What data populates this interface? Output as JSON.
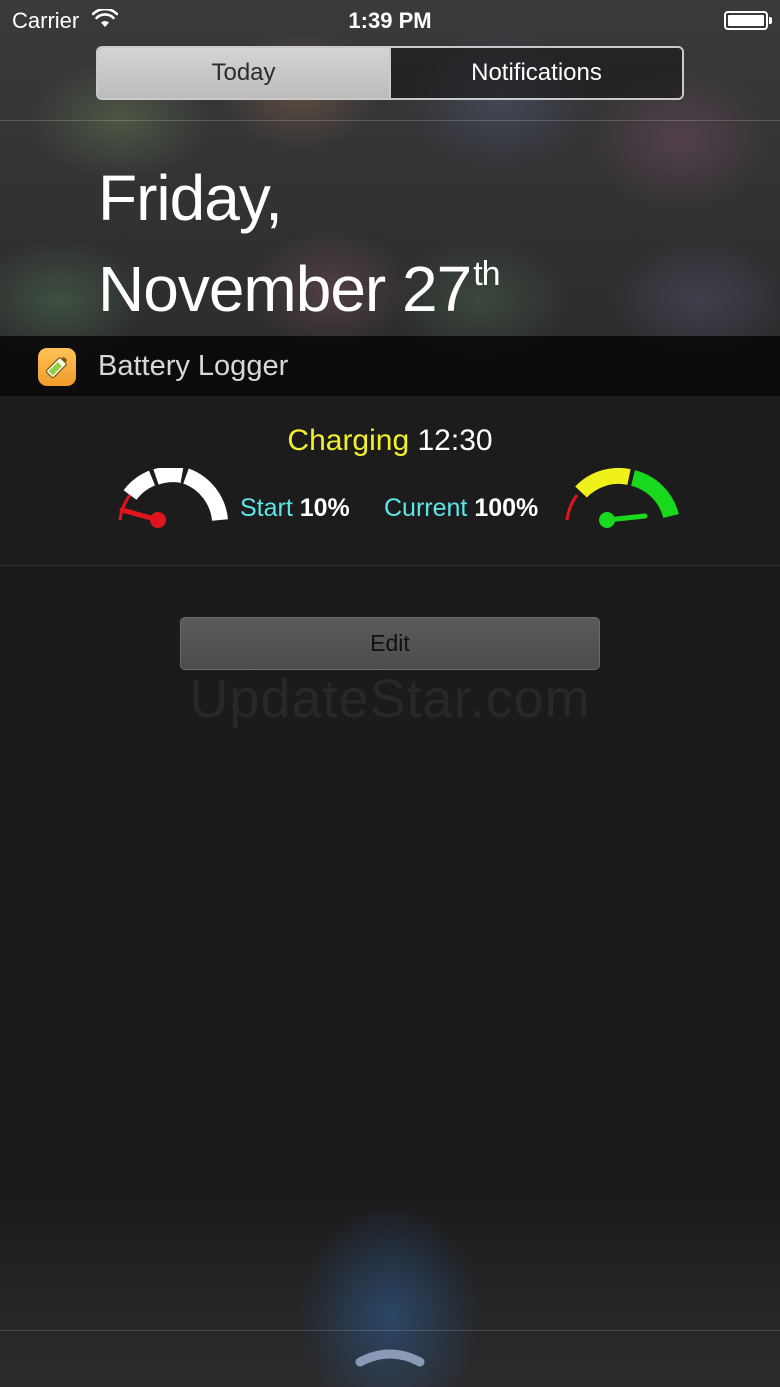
{
  "status_bar": {
    "carrier": "Carrier",
    "time": "1:39 PM"
  },
  "segmented_control": {
    "tabs": [
      {
        "label": "Today",
        "selected": true
      },
      {
        "label": "Notifications",
        "selected": false
      }
    ]
  },
  "date": {
    "line1": "Friday,",
    "line2": "November 27",
    "suffix": "th"
  },
  "widget": {
    "app_name": "Battery Logger",
    "app_icon": "battery-logger-app-icon",
    "charging_label": "Charging",
    "charging_time": "12:30",
    "start_label": "Start",
    "start_value": "10%",
    "start_level": 0.1,
    "current_label": "Current",
    "current_value": "100%",
    "current_level": 1.0,
    "colors": {
      "charging": "#f2ef2c",
      "labels": "#5de6ea",
      "gauge_low": "#e0141e",
      "gauge_mid": "#f0f01a",
      "gauge_high": "#19d81e"
    }
  },
  "edit_button": {
    "label": "Edit"
  },
  "watermark": "UpdateStar.com"
}
